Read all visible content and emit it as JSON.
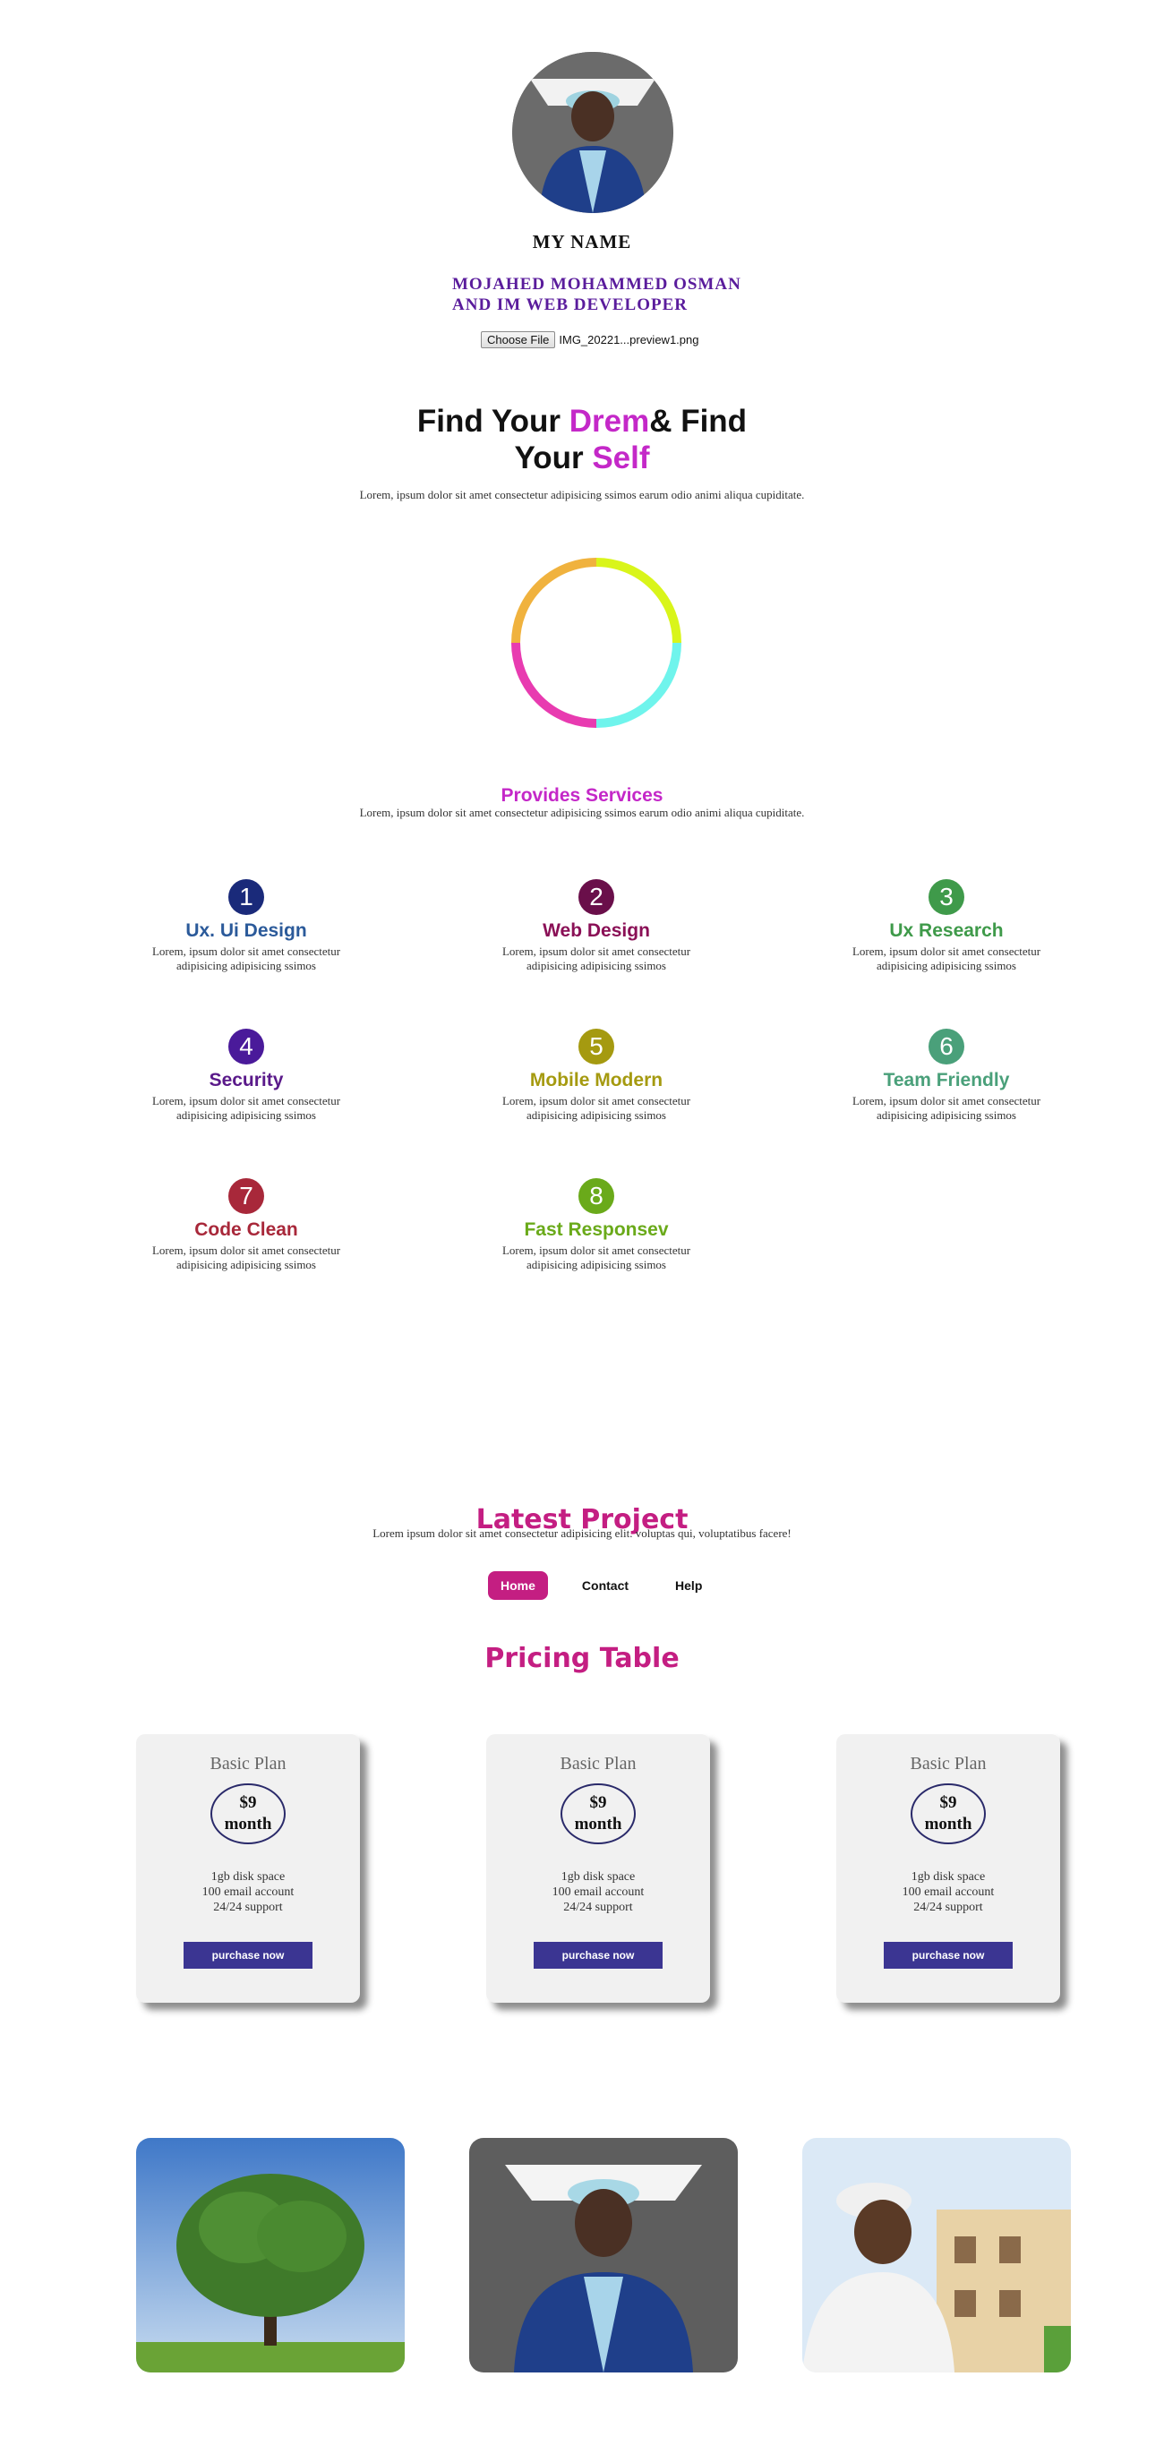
{
  "profile": {
    "name_heading": "MY NAME",
    "intro_line1": "MOJAHED MOHAMMED OSMAN",
    "intro_line2": "AND IM WEB DEVELOPER",
    "file_button": "Choose File",
    "file_name": "IMG_20221...preview1.png"
  },
  "hero": {
    "part1": "Find Your ",
    "part2": "Drem",
    "part3": "& Find",
    "part4": "Your ",
    "part5": "Self",
    "text": "Lorem, ipsum dolor sit amet consectetur adipisicing ssimos earum odio animi aliqua cupiditate."
  },
  "ring_colors": [
    "#d9f51a",
    "#6ff4ec",
    "#e83bb0",
    "#f0b23e"
  ],
  "services": {
    "title": "Provides Services",
    "text": "Lorem, ipsum dolor sit amet consectetur adipisicing ssimos earum odio animi aliqua cupiditate.",
    "items": [
      {
        "num": "1",
        "title": "Ux. Ui Design",
        "desc1": "Lorem, ipsum dolor sit amet consectetur",
        "desc2": "adipisicing adipisicing ssimos",
        "color": "#1a2a7a",
        "title_color": "#2b5a9a"
      },
      {
        "num": "2",
        "title": "Web Design",
        "desc1": "Lorem, ipsum dolor sit amet consectetur",
        "desc2": "adipisicing adipisicing ssimos",
        "color": "#6a0f4a",
        "title_color": "#8a1056"
      },
      {
        "num": "3",
        "title": "Ux Research",
        "desc1": "Lorem, ipsum dolor sit amet consectetur",
        "desc2": "adipisicing adipisicing ssimos",
        "color": "#3f9a4a",
        "title_color": "#3f9a4a"
      },
      {
        "num": "4",
        "title": "Security",
        "desc1": "Lorem, ipsum dolor sit amet consectetur",
        "desc2": "adipisicing adipisicing ssimos",
        "color": "#4a1a9a",
        "title_color": "#5a1a8a"
      },
      {
        "num": "5",
        "title": "Mobile Modern",
        "desc1": "Lorem, ipsum dolor sit amet consectetur",
        "desc2": "adipisicing adipisicing ssimos",
        "color": "#a59a10",
        "title_color": "#a59a10"
      },
      {
        "num": "6",
        "title": "Team Friendly",
        "desc1": "Lorem, ipsum dolor sit amet consectetur",
        "desc2": "adipisicing adipisicing ssimos",
        "color": "#4aa07a",
        "title_color": "#4aa07a"
      },
      {
        "num": "7",
        "title": "Code Clean",
        "desc1": "Lorem, ipsum dolor sit amet consectetur",
        "desc2": "adipisicing adipisicing ssimos",
        "color": "#a8283a",
        "title_color": "#a8283a"
      },
      {
        "num": "8",
        "title": "Fast Responsev",
        "desc1": "Lorem, ipsum dolor sit amet consectetur",
        "desc2": "adipisicing adipisicing ssimos",
        "color": "#6aaa1a",
        "title_color": "#6aaa1a"
      }
    ]
  },
  "latest": {
    "title": "Latest Project",
    "text": "Lorem ipsum dolor sit amet consectetur adipisicing elit. voluptas qui, voluptatibus facere!",
    "tabs": [
      "Home",
      "Contact",
      "Help"
    ]
  },
  "pricing": {
    "title": "Pricing Table",
    "cards": [
      {
        "plan": "Basic Plan",
        "price": "$9",
        "period": "month",
        "f1": "1gb disk space",
        "f2": "100 email account",
        "f3": "24/24 support",
        "button": "purchase now"
      },
      {
        "plan": "Basic Plan",
        "price": "$9",
        "period": "month",
        "f1": "1gb disk space",
        "f2": "100 email account",
        "f3": "24/24 support",
        "button": "purchase now"
      },
      {
        "plan": "Basic Plan",
        "price": "$9",
        "period": "month",
        "f1": "1gb disk space",
        "f2": "100 email account",
        "f3": "24/24 support",
        "button": "purchase now"
      }
    ]
  }
}
